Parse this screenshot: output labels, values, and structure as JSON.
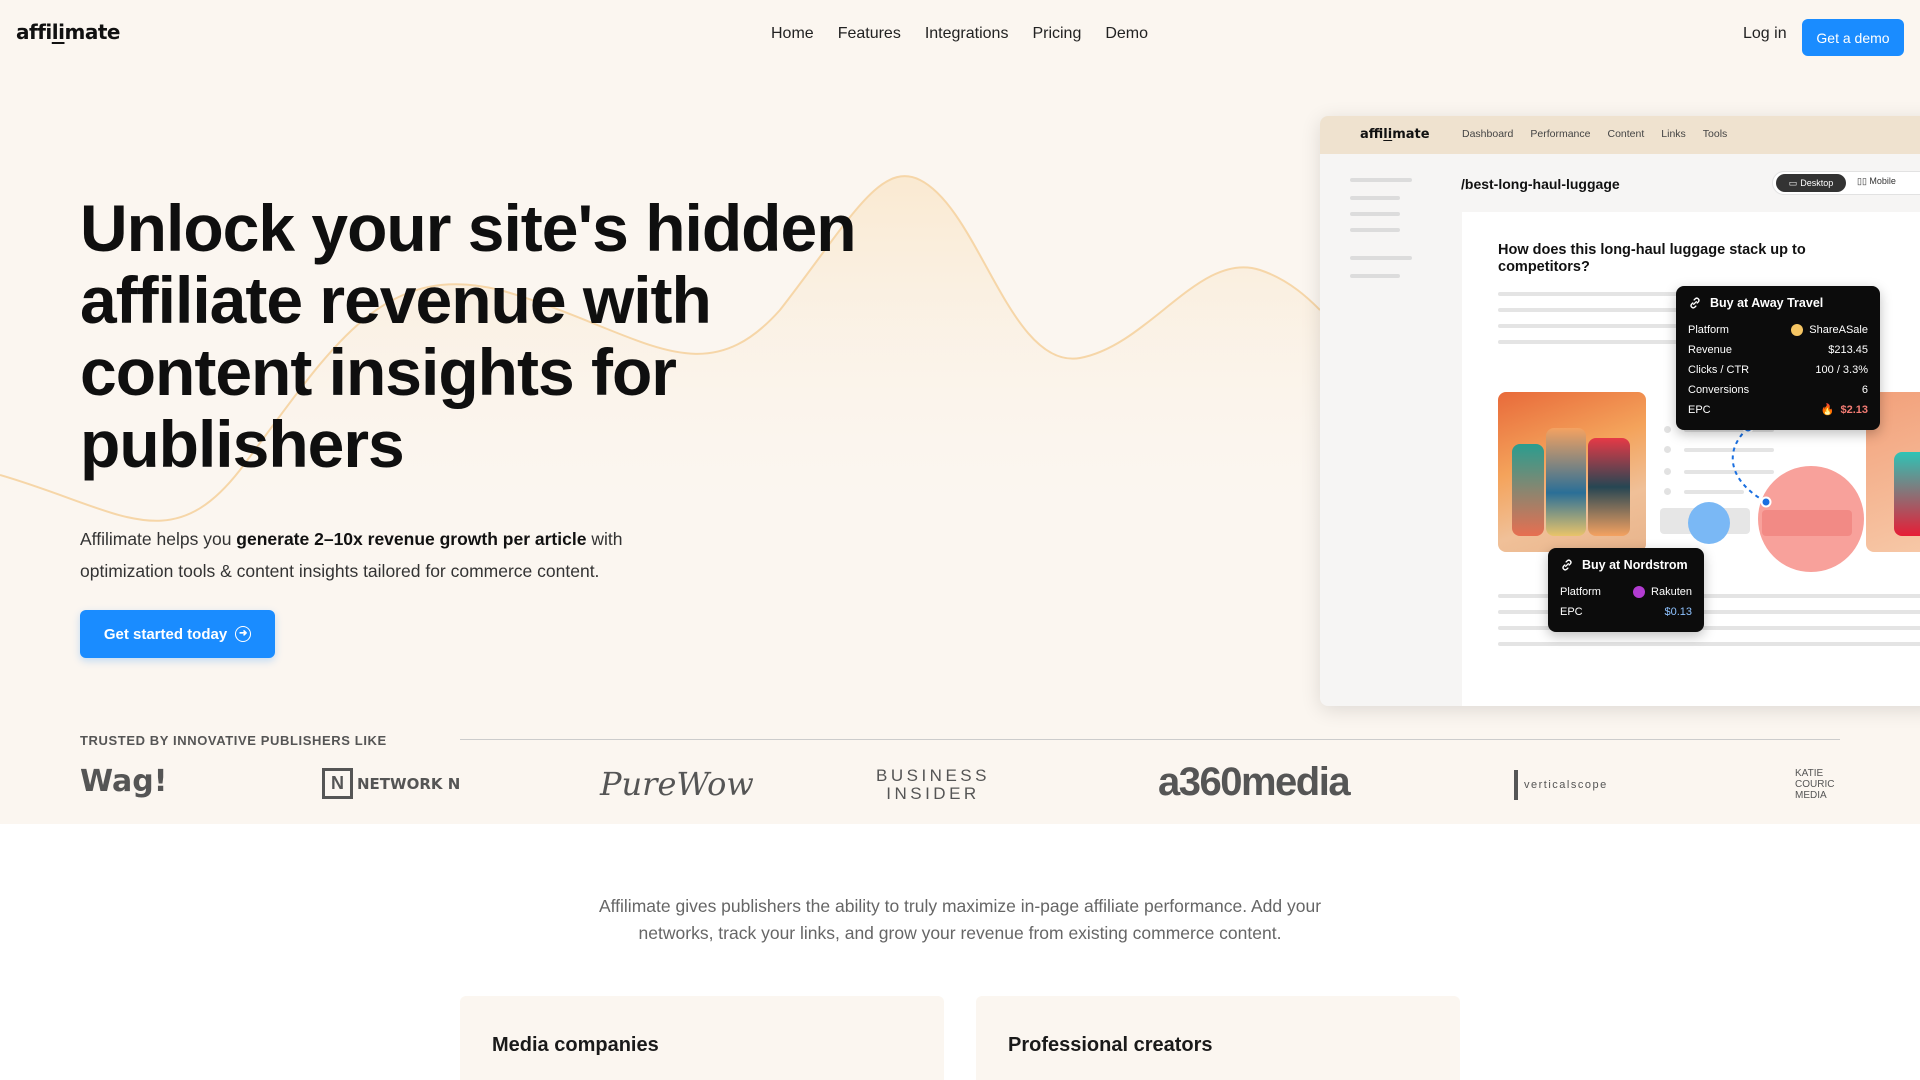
{
  "brand": {
    "logo_prefix": "affi",
    "logo_under": "li",
    "logo_suffix": "mate"
  },
  "nav": {
    "links": [
      "Home",
      "Features",
      "Integrations",
      "Pricing",
      "Demo"
    ],
    "login": "Log in",
    "demo_button": "Get a demo"
  },
  "hero": {
    "headline": "Unlock your site's hidden affiliate revenue with content insights for publishers",
    "sub_pre": "Affilimate helps you ",
    "sub_bold": "generate 2–10x revenue growth per article",
    "sub_post": " with optimization tools & content insights tailored for commerce content.",
    "cta": "Get started today"
  },
  "mockup": {
    "tabs": [
      "Dashboard",
      "Performance",
      "Content",
      "Links",
      "Tools"
    ],
    "path": "/best-long-haul-luggage",
    "view_desktop": "Desktop",
    "view_mobile": "Mobile",
    "question": "How does this long-haul luggage stack up to competitors?",
    "tooltip1": {
      "title": "Buy at Away Travel",
      "rows": [
        {
          "label": "Platform",
          "value": "ShareASale"
        },
        {
          "label": "Revenue",
          "value": "$213.45"
        },
        {
          "label": "Clicks / CTR",
          "value": "100 / 3.3%"
        },
        {
          "label": "Conversions",
          "value": "6"
        },
        {
          "label": "EPC",
          "value": "$2.13"
        }
      ],
      "platform_color": "#f5c563",
      "epc_color": "#f27b73"
    },
    "tooltip2": {
      "title": "Buy at Nordstrom",
      "rows": [
        {
          "label": "Platform",
          "value": "Rakuten"
        },
        {
          "label": "EPC",
          "value": "$0.13"
        }
      ],
      "platform_color": "#b23cd1",
      "epc_color": "#8ec2ff"
    }
  },
  "trusted": {
    "label": "TRUSTED BY INNOVATIVE PUBLISHERS LIKE",
    "logos": [
      "Wag!",
      "NETWORK N",
      "PureWow",
      "BUSINESS",
      "INSIDER",
      "a360media",
      "verticalscope",
      "KATIE",
      "COURIC",
      "MEDIA"
    ]
  },
  "about": {
    "description": "Affilimate gives publishers the ability to truly maximize in-page affiliate performance. Add your networks, track your links, and grow your revenue from existing commerce content.",
    "cards": [
      "Media companies",
      "Professional creators"
    ]
  },
  "colors": {
    "accent": "#1a8cff",
    "hero_bg": "#fbf6f0"
  }
}
